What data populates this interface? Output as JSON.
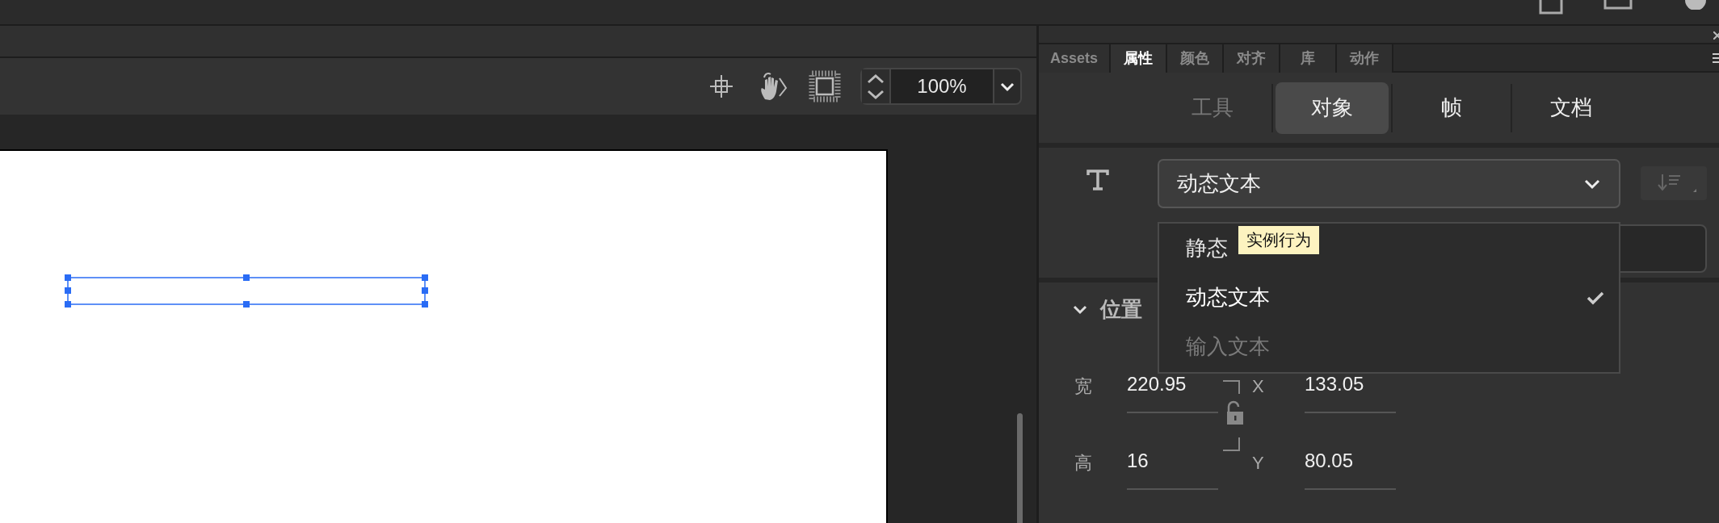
{
  "stage_toolbar": {
    "zoom": "100%"
  },
  "panel": {
    "tabs": [
      {
        "label": "Assets",
        "selected": false
      },
      {
        "label": "属性",
        "selected": true
      },
      {
        "label": "颜色",
        "selected": false
      },
      {
        "label": "对齐",
        "selected": false
      },
      {
        "label": "库",
        "selected": false
      },
      {
        "label": "动作",
        "selected": false
      }
    ],
    "views": [
      {
        "label": "工具",
        "selected": false,
        "disabled": true
      },
      {
        "label": "对象",
        "selected": true,
        "disabled": false
      },
      {
        "label": "帧",
        "selected": false,
        "disabled": false
      },
      {
        "label": "文档",
        "selected": false,
        "disabled": false
      }
    ]
  },
  "text_type": {
    "value": "动态文本",
    "expanded": true,
    "options": [
      {
        "label": "静态",
        "selected": false,
        "disabled": false
      },
      {
        "label": "动态文本",
        "selected": true,
        "disabled": false
      },
      {
        "label": "输入文本",
        "selected": false,
        "disabled": true
      }
    ]
  },
  "tooltip": "实例行为",
  "section": {
    "title": "位置",
    "expanded": true
  },
  "fields": [
    {
      "label": "宽",
      "value": "220.95"
    },
    {
      "label": "X",
      "value": "133.05"
    },
    {
      "label": "高",
      "value": "16"
    },
    {
      "label": "Y",
      "value": "80.05"
    }
  ],
  "lock": {
    "locked": false
  }
}
